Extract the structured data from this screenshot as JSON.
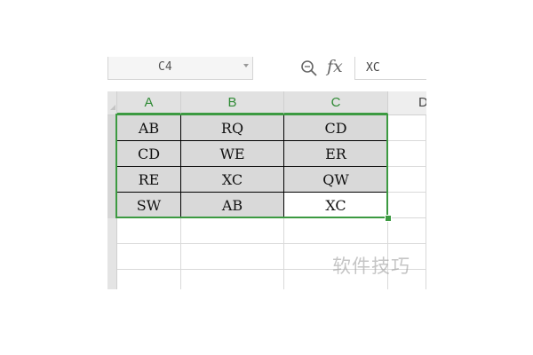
{
  "formula_bar": {
    "name_box": "C4",
    "fx_label": "fx",
    "formula_value": "XC"
  },
  "columns": [
    {
      "label": "A",
      "selected": true
    },
    {
      "label": "B",
      "selected": true
    },
    {
      "label": "C",
      "selected": true
    },
    {
      "label": "D",
      "selected": false
    }
  ],
  "rows": [
    [
      "AB",
      "RQ",
      "CD"
    ],
    [
      "CD",
      "WE",
      "ER"
    ],
    [
      "RE",
      "XC",
      "QW"
    ],
    [
      "SW",
      "AB",
      "XC"
    ]
  ],
  "selection": {
    "range": "A1:C4",
    "active_cell": "C4",
    "accent_color": "#3c9a41"
  },
  "watermark": "软件技巧"
}
